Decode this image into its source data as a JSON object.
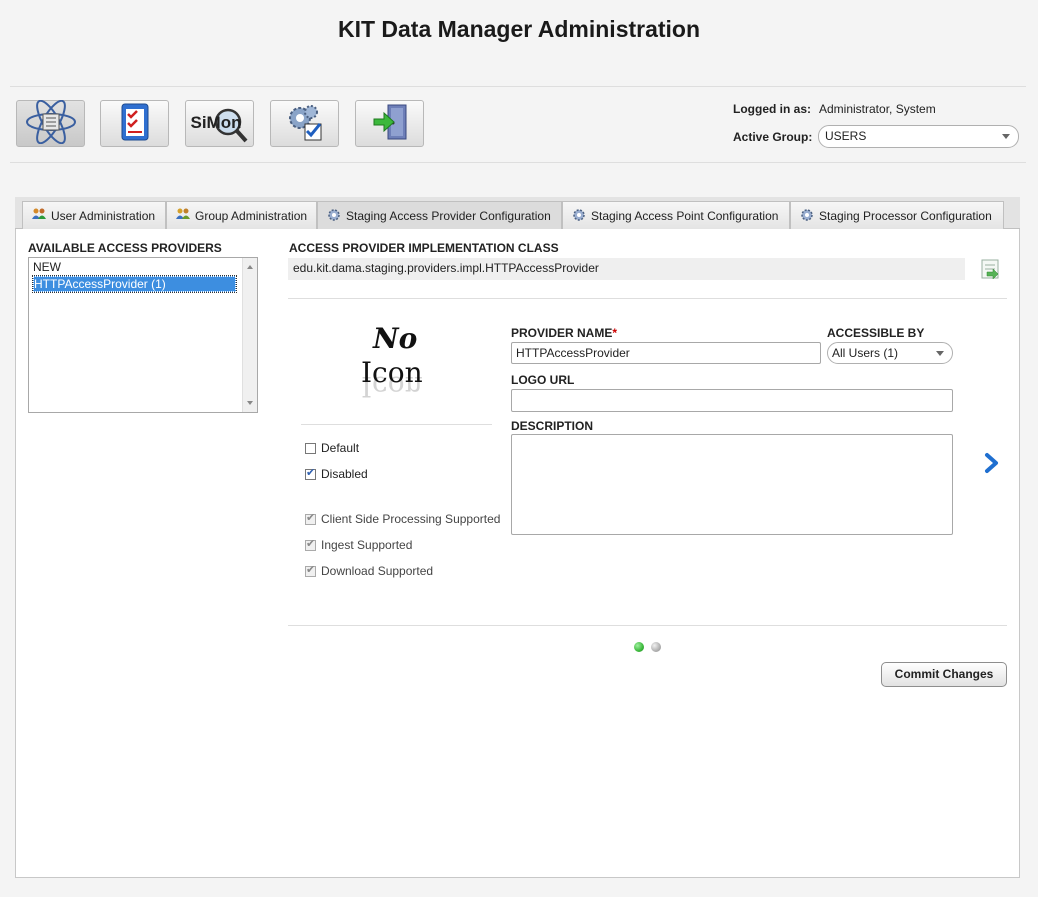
{
  "app": {
    "title": "KIT Data Manager Administration"
  },
  "toolbar": {
    "buttons": [
      {
        "name": "administration-button",
        "icon": "atom-list-icon"
      },
      {
        "name": "checklist-button",
        "icon": "checklist-icon"
      },
      {
        "name": "simon-button",
        "icon": "simon-magnifier-icon",
        "label": "SiMon"
      },
      {
        "name": "settings-button",
        "icon": "gears-check-icon"
      },
      {
        "name": "logout-button",
        "icon": "exit-door-icon"
      }
    ]
  },
  "login": {
    "logged_in_label": "Logged in as:",
    "logged_in_value": "Administrator, System",
    "group_label": "Active Group:",
    "group_value": "USERS"
  },
  "tabs": [
    {
      "label": "User Administration",
      "icon": "users-icon"
    },
    {
      "label": "Group Administration",
      "icon": "group-icon"
    },
    {
      "label": "Staging Access Provider Configuration",
      "icon": "gear-icon"
    },
    {
      "label": "Staging Access Point Configuration",
      "icon": "gear-icon"
    },
    {
      "label": "Staging Processor Configuration",
      "icon": "gear-icon"
    }
  ],
  "providers": {
    "label": "AVAILABLE ACCESS PROVIDERS",
    "items": [
      "NEW",
      "HTTPAccessProvider (1)"
    ],
    "selected": "HTTPAccessProvider (1)"
  },
  "impl": {
    "label": "ACCESS PROVIDER IMPLEMENTATION CLASS",
    "value": "edu.kit.dama.staging.providers.impl.HTTPAccessProvider"
  },
  "icon_placeholder": {
    "line1": "No",
    "line2": "Icon"
  },
  "form": {
    "name_label": "PROVIDER NAME",
    "required_mark": "*",
    "name_value": "HTTPAccessProvider",
    "accessible_label": "ACCESSIBLE BY",
    "accessible_value": "All Users (1)",
    "logo_label": "LOGO URL",
    "logo_value": "",
    "desc_label": "DESCRIPTION",
    "desc_value": ""
  },
  "checkboxes": {
    "default": {
      "label": "Default",
      "checked": false
    },
    "disabled": {
      "label": "Disabled",
      "checked": true
    },
    "client_side": {
      "label": "Client Side Processing Supported",
      "checked": true
    },
    "ingest": {
      "label": "Ingest Supported",
      "checked": true
    },
    "download": {
      "label": "Download Supported",
      "checked": true
    }
  },
  "pager": {
    "pages": 2,
    "current": 1
  },
  "actions": {
    "commit_label": "Commit Changes"
  },
  "colors": {
    "accent": "#3d8ee0",
    "required": "#cc0000",
    "pager_active": "#3cb83c",
    "pager_inactive": "#b0b0b0"
  }
}
